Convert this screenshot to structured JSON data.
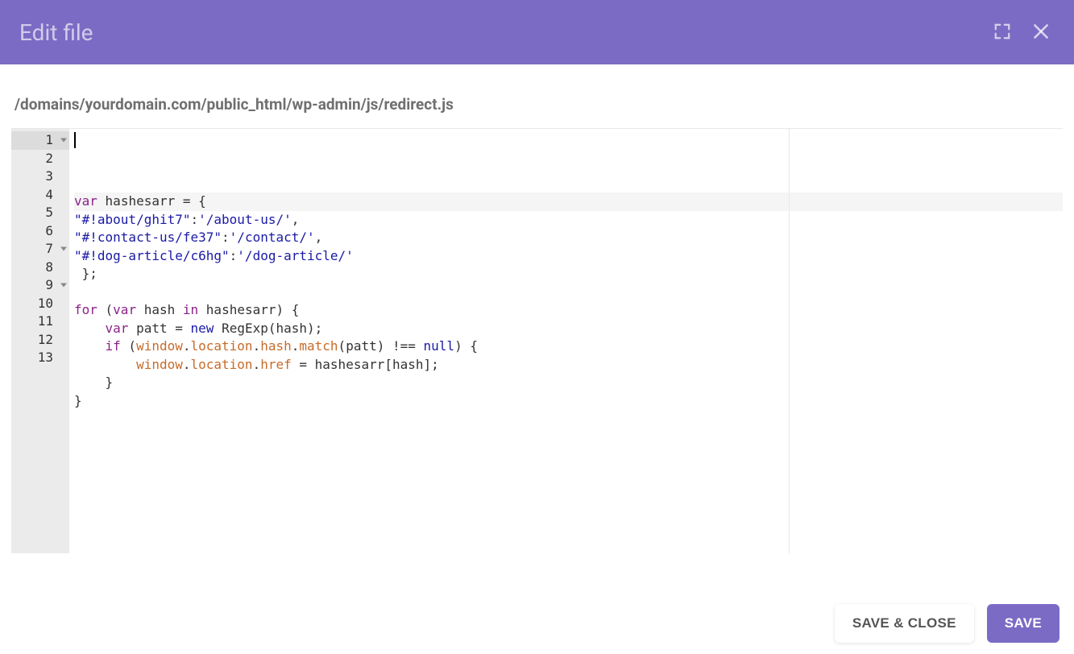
{
  "header": {
    "title": "Edit file"
  },
  "file_path": "/domains/yourdomain.com/public_html/wp-admin/js/redirect.js",
  "editor": {
    "active_line": 1,
    "lines": [
      {
        "num": 1,
        "fold": true,
        "tokens": [
          [
            "kw",
            "var"
          ],
          [
            "punct",
            " "
          ],
          [
            "ident",
            "hashesarr"
          ],
          [
            "punct",
            " "
          ],
          [
            "op",
            "="
          ],
          [
            "punct",
            " "
          ],
          [
            "punct",
            "{"
          ]
        ]
      },
      {
        "num": 2,
        "fold": false,
        "tokens": [
          [
            "str",
            "\"#!about/ghit7\""
          ],
          [
            "punct",
            ":"
          ],
          [
            "str",
            "'/about-us/'"
          ],
          [
            "punct",
            ","
          ]
        ]
      },
      {
        "num": 3,
        "fold": false,
        "tokens": [
          [
            "str",
            "\"#!contact-us/fe37\""
          ],
          [
            "punct",
            ":"
          ],
          [
            "str",
            "'/contact/'"
          ],
          [
            "punct",
            ","
          ]
        ]
      },
      {
        "num": 4,
        "fold": false,
        "tokens": [
          [
            "str",
            "\"#!dog-article/c6hg\""
          ],
          [
            "punct",
            ":"
          ],
          [
            "str",
            "'/dog-article/'"
          ]
        ]
      },
      {
        "num": 5,
        "fold": false,
        "tokens": [
          [
            "punct",
            " };"
          ]
        ]
      },
      {
        "num": 6,
        "fold": false,
        "tokens": []
      },
      {
        "num": 7,
        "fold": true,
        "tokens": [
          [
            "kw",
            "for"
          ],
          [
            "punct",
            " ("
          ],
          [
            "kw",
            "var"
          ],
          [
            "punct",
            " "
          ],
          [
            "ident",
            "hash"
          ],
          [
            "punct",
            " "
          ],
          [
            "kw",
            "in"
          ],
          [
            "punct",
            " "
          ],
          [
            "ident",
            "hashesarr"
          ],
          [
            "punct",
            ") {"
          ]
        ]
      },
      {
        "num": 8,
        "fold": false,
        "tokens": [
          [
            "punct",
            "    "
          ],
          [
            "kw",
            "var"
          ],
          [
            "punct",
            " "
          ],
          [
            "ident",
            "patt"
          ],
          [
            "punct",
            " "
          ],
          [
            "op",
            "="
          ],
          [
            "punct",
            " "
          ],
          [
            "new",
            "new"
          ],
          [
            "punct",
            " "
          ],
          [
            "class",
            "RegExp"
          ],
          [
            "punct",
            "("
          ],
          [
            "ident",
            "hash"
          ],
          [
            "punct",
            ");"
          ]
        ]
      },
      {
        "num": 9,
        "fold": true,
        "tokens": [
          [
            "punct",
            "    "
          ],
          [
            "kw",
            "if"
          ],
          [
            "punct",
            " ("
          ],
          [
            "builtin",
            "window"
          ],
          [
            "punct",
            "."
          ],
          [
            "builtin",
            "location"
          ],
          [
            "punct",
            "."
          ],
          [
            "builtin",
            "hash"
          ],
          [
            "punct",
            "."
          ],
          [
            "builtin",
            "match"
          ],
          [
            "punct",
            "("
          ],
          [
            "ident",
            "patt"
          ],
          [
            "punct",
            ") "
          ],
          [
            "op",
            "!=="
          ],
          [
            "punct",
            " "
          ],
          [
            "null",
            "null"
          ],
          [
            "punct",
            ") {"
          ]
        ]
      },
      {
        "num": 10,
        "fold": false,
        "tokens": [
          [
            "punct",
            "        "
          ],
          [
            "builtin",
            "window"
          ],
          [
            "punct",
            "."
          ],
          [
            "builtin",
            "location"
          ],
          [
            "punct",
            "."
          ],
          [
            "builtin",
            "href"
          ],
          [
            "punct",
            " "
          ],
          [
            "op",
            "="
          ],
          [
            "punct",
            " "
          ],
          [
            "ident",
            "hashesarr"
          ],
          [
            "punct",
            "["
          ],
          [
            "ident",
            "hash"
          ],
          [
            "punct",
            "];"
          ]
        ]
      },
      {
        "num": 11,
        "fold": false,
        "tokens": [
          [
            "punct",
            "    }"
          ]
        ]
      },
      {
        "num": 12,
        "fold": false,
        "tokens": [
          [
            "punct",
            "}"
          ]
        ]
      },
      {
        "num": 13,
        "fold": false,
        "tokens": []
      }
    ]
  },
  "footer": {
    "save_close_label": "SAVE & CLOSE",
    "save_label": "SAVE"
  }
}
